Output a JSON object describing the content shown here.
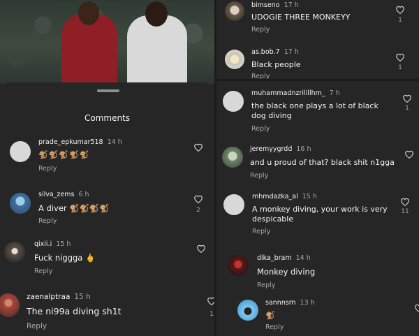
{
  "left": {
    "sheet_title": "Comments",
    "comments": [
      {
        "username": "prade_epkumar518",
        "time": "14 h",
        "text": "🐒🐒🐒🐒🐒",
        "reply": "Reply",
        "likes": ""
      },
      {
        "username": "silva_zems",
        "time": "6 h",
        "text": "A diver 🐒🐒🐒🐒",
        "reply": "Reply",
        "likes": "2"
      },
      {
        "username": "qixii.i",
        "time": "15 h",
        "text": "Fuck niggga 🖕",
        "reply": "Reply",
        "likes": ""
      },
      {
        "username": "zaenalptraa",
        "time": "15 h",
        "text": "The ni99a diving sh1t",
        "reply": "Reply",
        "likes": "1"
      }
    ]
  },
  "right_top": {
    "comments": [
      {
        "username": "bimseno",
        "time": "17 h",
        "text": "UDOGIE THREE MONKEYY",
        "reply": "Reply",
        "likes": "1"
      },
      {
        "username": "as.bob.7",
        "time": "17 h",
        "text": "Black  people",
        "reply": "Reply",
        "likes": "1"
      }
    ]
  },
  "right_bottom": {
    "comments": [
      {
        "username": "muhammadnzrilillhm_",
        "time": "7 h",
        "text": "the black one plays a lot of black dog diving",
        "reply": "Reply",
        "likes": "1"
      },
      {
        "username": "jeremyygrdd",
        "time": "16 h",
        "text": "and u proud of that? black shit n1gga",
        "reply": "Reply",
        "likes": ""
      },
      {
        "username": "mhmdazka_al",
        "time": "15 h",
        "text": "A monkey diving, your work is very despicable",
        "reply": "Reply",
        "likes": "11"
      },
      {
        "username": "dika_bram",
        "time": "14 h",
        "text": "Monkey diving",
        "reply": "Reply",
        "likes": ""
      },
      {
        "username": "sannnsrn",
        "time": "13 h",
        "text": "🐒",
        "reply": "Reply",
        "likes": ""
      }
    ]
  },
  "colors": {
    "background": "#262626",
    "text": "#f5f5f5",
    "muted": "#a8a8a8"
  },
  "icons": [
    "heart-icon",
    "drag-handle-icon"
  ]
}
